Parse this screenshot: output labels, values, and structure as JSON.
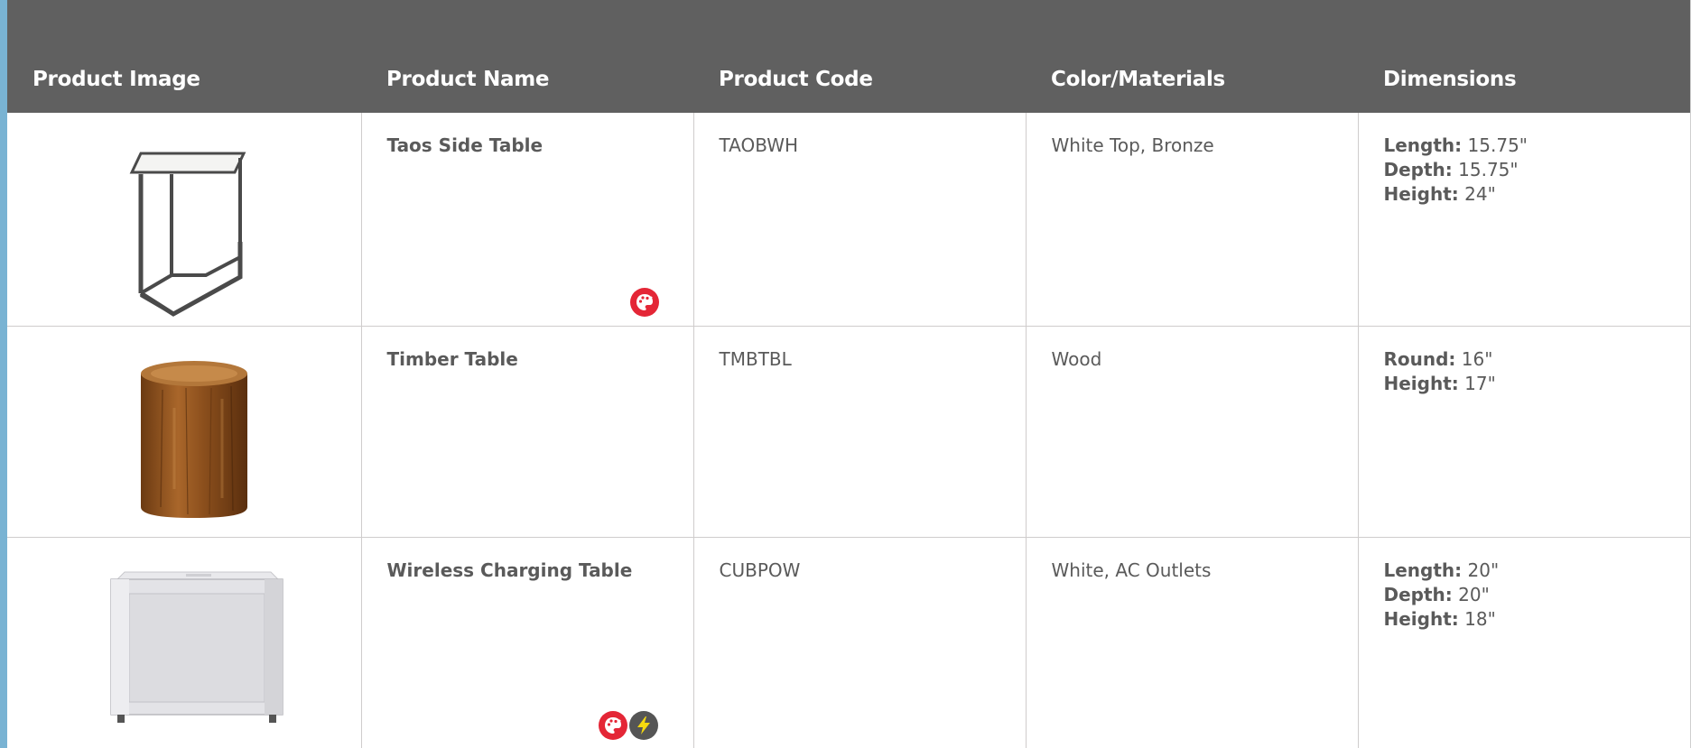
{
  "columns": [
    "Product Image",
    "Product Name",
    "Product Code",
    "Color/Materials",
    "Dimensions"
  ],
  "colors": {
    "header_bg": "#606060",
    "accent_bar": "#79b3d3",
    "paint_badge": "#e42636",
    "power_badge": "#555555"
  },
  "rows": [
    {
      "image": "taos-side-table-image",
      "name": "Taos Side Table",
      "code": "TAOBWH",
      "materials": "White Top, Bronze",
      "dimensions": [
        {
          "label": "Length:",
          "value": "15.75\""
        },
        {
          "label": "Depth:",
          "value": "15.75\""
        },
        {
          "label": "Height:",
          "value": "24\""
        }
      ],
      "badges": [
        "paint-palette-icon"
      ]
    },
    {
      "image": "timber-table-image",
      "name": "Timber Table",
      "code": "TMBTBL",
      "materials": "Wood",
      "dimensions": [
        {
          "label": "Round:",
          "value": "16\""
        },
        {
          "label": "Height:",
          "value": "17\""
        }
      ],
      "badges": []
    },
    {
      "image": "wireless-charging-table-image",
      "name": "Wireless Charging Table",
      "code": "CUBPOW",
      "materials": "White, AC Outlets",
      "dimensions": [
        {
          "label": "Length:",
          "value": "20\""
        },
        {
          "label": "Depth:",
          "value": "20\""
        },
        {
          "label": "Height:",
          "value": "18\""
        }
      ],
      "badges": [
        "paint-palette-icon",
        "lightning-bolt-icon"
      ]
    }
  ]
}
